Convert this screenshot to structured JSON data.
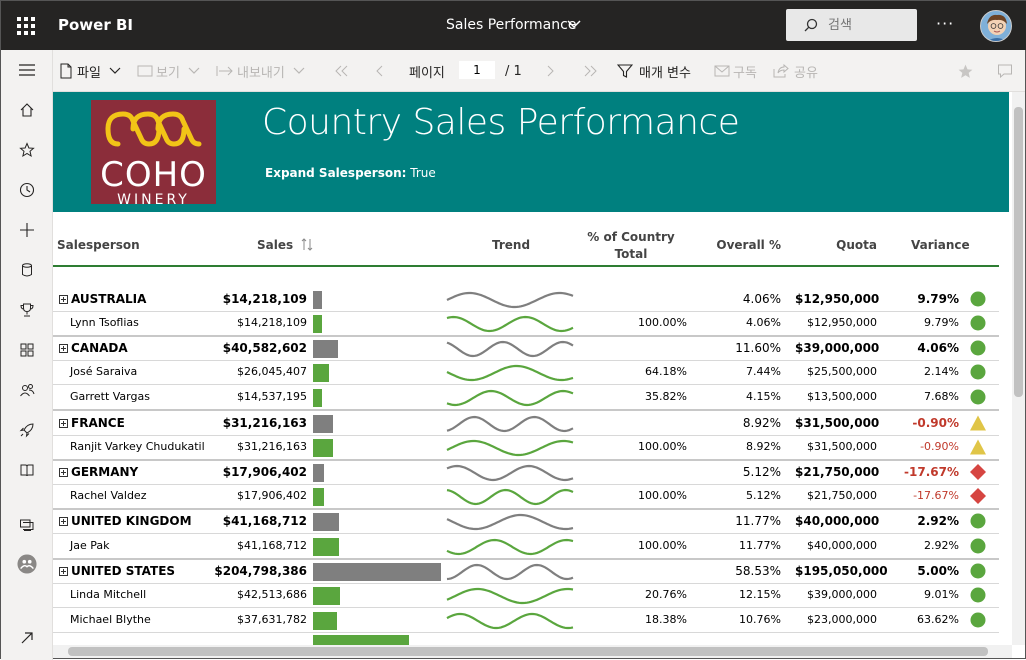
{
  "app": {
    "name": "Power BI",
    "report_title": "Sales Performance",
    "search_placeholder": "검색"
  },
  "toolbar": {
    "file": "파일",
    "view": "보기",
    "export": "내보내기",
    "page_label": "페이지",
    "page_current": "1",
    "page_total": "/ 1",
    "params": "매개 변수",
    "subscribe": "구독",
    "share": "공유"
  },
  "banner": {
    "title": "Country Sales Performance",
    "param_label": "Expand Salesperson:",
    "param_value": "True",
    "logo_line1": "COHO",
    "logo_line2": "WINERY"
  },
  "headers": {
    "salesperson": "Salesperson",
    "sales": "Sales",
    "trend": "Trend",
    "pct_line1": "% of Country",
    "pct_line2": "Total",
    "overall": "Overall %",
    "quota": "Quota",
    "variance": "Variance"
  },
  "rows": [
    {
      "type": "country",
      "name": "AUSTRALIA",
      "sales": "$14,218,109",
      "sales_value": 14218109,
      "pct": "",
      "overall": "4.06%",
      "quota": "$12,950,000",
      "variance": "9.79%",
      "status": "good"
    },
    {
      "type": "person",
      "name": "Lynn Tsoflias",
      "sales": "$14,218,109",
      "sales_value": 14218109,
      "pct": "100.00%",
      "overall": "4.06%",
      "quota": "$12,950,000",
      "variance": "9.79%",
      "status": "good"
    },
    {
      "type": "country",
      "name": "CANADA",
      "sales": "$40,582,602",
      "sales_value": 40582602,
      "pct": "",
      "overall": "11.60%",
      "quota": "$39,000,000",
      "variance": "4.06%",
      "status": "good"
    },
    {
      "type": "person",
      "name": "José Saraiva",
      "sales": "$26,045,407",
      "sales_value": 26045407,
      "pct": "64.18%",
      "overall": "7.44%",
      "quota": "$25,500,000",
      "variance": "2.14%",
      "status": "good"
    },
    {
      "type": "person",
      "name": "Garrett Vargas",
      "sales": "$14,537,195",
      "sales_value": 14537195,
      "pct": "35.82%",
      "overall": "4.15%",
      "quota": "$13,500,000",
      "variance": "7.68%",
      "status": "good"
    },
    {
      "type": "country",
      "name": "FRANCE",
      "sales": "$31,216,163",
      "sales_value": 31216163,
      "pct": "",
      "overall": "8.92%",
      "quota": "$31,500,000",
      "variance": "-0.90%",
      "status": "warn"
    },
    {
      "type": "person",
      "name": "Ranjit Varkey Chudukatil",
      "sales": "$31,216,163",
      "sales_value": 31216163,
      "pct": "100.00%",
      "overall": "8.92%",
      "quota": "$31,500,000",
      "variance": "-0.90%",
      "status": "warn"
    },
    {
      "type": "country",
      "name": "GERMANY",
      "sales": "$17,906,402",
      "sales_value": 17906402,
      "pct": "",
      "overall": "5.12%",
      "quota": "$21,750,000",
      "variance": "-17.67%",
      "status": "bad"
    },
    {
      "type": "person",
      "name": "Rachel Valdez",
      "sales": "$17,906,402",
      "sales_value": 17906402,
      "pct": "100.00%",
      "overall": "5.12%",
      "quota": "$21,750,000",
      "variance": "-17.67%",
      "status": "bad"
    },
    {
      "type": "country",
      "name": "UNITED KINGDOM",
      "sales": "$41,168,712",
      "sales_value": 41168712,
      "pct": "",
      "overall": "11.77%",
      "quota": "$40,000,000",
      "variance": "2.92%",
      "status": "good"
    },
    {
      "type": "person",
      "name": "Jae Pak",
      "sales": "$41,168,712",
      "sales_value": 41168712,
      "pct": "100.00%",
      "overall": "11.77%",
      "quota": "$40,000,000",
      "variance": "2.92%",
      "status": "good"
    },
    {
      "type": "country",
      "name": "UNITED STATES",
      "sales": "$204,798,386",
      "sales_value": 204798386,
      "pct": "",
      "overall": "58.53%",
      "quota": "$195,050,000",
      "variance": "5.00%",
      "status": "good"
    },
    {
      "type": "person",
      "name": "Linda Mitchell",
      "sales": "$42,513,686",
      "sales_value": 42513686,
      "pct": "20.76%",
      "overall": "12.15%",
      "quota": "$39,000,000",
      "variance": "9.01%",
      "status": "good"
    },
    {
      "type": "person",
      "name": "Michael Blythe",
      "sales": "$37,631,782",
      "sales_value": 37631782,
      "pct": "18.38%",
      "overall": "10.76%",
      "quota": "$23,000,000",
      "variance": "63.62%",
      "status": "good"
    }
  ],
  "colors": {
    "teal": "#00807f",
    "good": "#5aa63e",
    "warn": "#e0c547",
    "bad": "#d64541",
    "bar_country": "#7f7f7f",
    "bar_person": "#5aa63e",
    "neg_text": "#c0392b"
  }
}
